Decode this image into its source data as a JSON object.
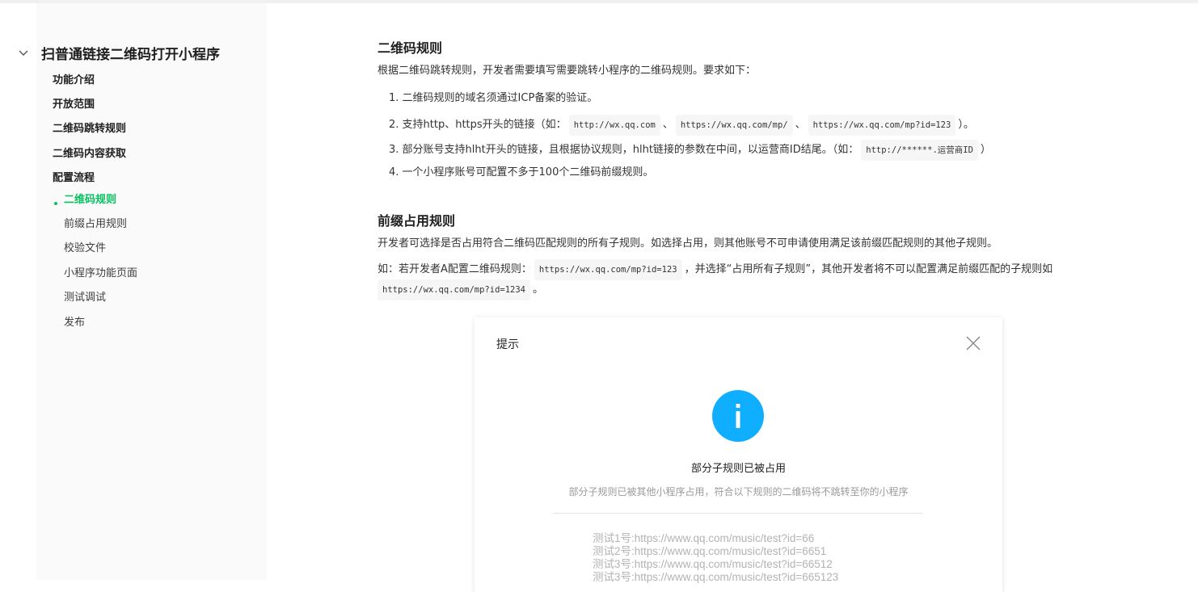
{
  "sidebar": {
    "title": "扫普通链接二维码打开小程序",
    "items": [
      {
        "label": "功能介绍",
        "level": 1,
        "active": false
      },
      {
        "label": "开放范围",
        "level": 1,
        "active": false
      },
      {
        "label": "二维码跳转规则",
        "level": 1,
        "active": false
      },
      {
        "label": "二维码内容获取",
        "level": 1,
        "active": false
      },
      {
        "label": "配置流程",
        "level": 1,
        "active": false
      },
      {
        "label": "二维码规则",
        "level": 2,
        "active": true
      },
      {
        "label": "前缀占用规则",
        "level": 2,
        "active": false
      },
      {
        "label": "校验文件",
        "level": 2,
        "active": false
      },
      {
        "label": "小程序功能页面",
        "level": 2,
        "active": false
      },
      {
        "label": "测试调试",
        "level": 2,
        "active": false
      },
      {
        "label": "发布",
        "level": 2,
        "active": false
      }
    ]
  },
  "section1": {
    "heading": "二维码规则",
    "intro": "根据二维码跳转规则，开发者需要填写需要跳转小程序的二维码规则。要求如下：",
    "item1": "1. 二维码规则的域名须通过ICP备案的验证。",
    "item2_prefix": "2. 支持http、https开头的链接（如：",
    "item2_code1": "http://wx.qq.com",
    "item2_sep1": "、",
    "item2_code2": "https://wx.qq.com/mp/",
    "item2_sep2": "、",
    "item2_code3": "https://wx.qq.com/mp?id=123",
    "item2_suffix": "）。",
    "item3_prefix": "3. 部分账号支持hlht开头的链接，且根据协议规则，hlht链接的参数在中间，以运营商ID结尾。（如：",
    "item3_code": "http://******.运营商ID",
    "item3_suffix": "）",
    "item4": "4. 一个小程序账号可配置不多于100个二维码前缀规则。"
  },
  "section2": {
    "heading": "前缀占用规则",
    "para1": "开发者可选择是否占用符合二维码匹配规则的所有子规则。如选择占用，则其他账号不可申请使用满足该前缀匹配规则的其他子规则。",
    "para2_prefix": "如：若开发者A配置二维码规则：",
    "para2_code1": "https://wx.qq.com/mp?id=123",
    "para2_middle": "，并选择“占用所有子规则”，其他开发者将不可以配置满足前缀匹配的子规则如",
    "para2_code2": "https://wx.qq.com/mp?id=1234",
    "para2_suffix": "。"
  },
  "dialog": {
    "title": "提示",
    "headline": "部分子规则已被占用",
    "description": "部分子规则已被其他小程序占用，符合以下规则的二维码将不跳转至你的小程序",
    "rules": [
      "测试1号:https://www.qq.com/music/test?id=66",
      "测试2号:https://www.qq.com/music/test?id=6651",
      "测试3号:https://www.qq.com/music/test?id=66512",
      "测试3号:https://www.qq.com/music/test?id=665123"
    ]
  },
  "colors": {
    "accent": "#07c160",
    "info": "#10aeff"
  },
  "icons": {
    "toc_toggle": "chevron-down-icon",
    "dialog_close": "close-icon",
    "dialog_info": "info-icon"
  }
}
